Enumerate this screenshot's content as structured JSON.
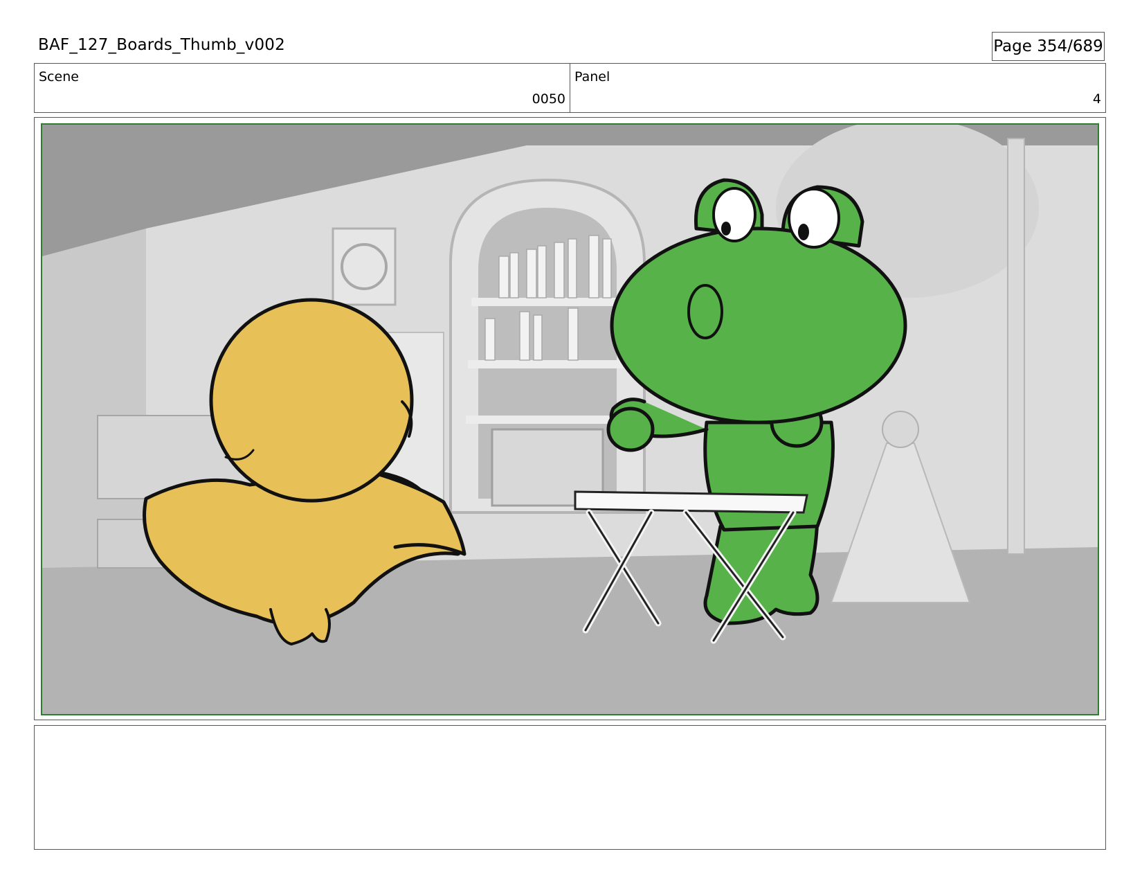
{
  "header": {
    "doc_title": "BAF_127_Boards_Thumb_v002",
    "page_label": "Page 354/689"
  },
  "info": {
    "scene_label": "Scene",
    "scene_value": "0050",
    "panel_label": "Panel",
    "panel_value": "4"
  },
  "notes": {
    "text": ""
  },
  "colors": {
    "frame_border": "#2f7d2f",
    "duck_fill": "#e8c058",
    "frog_fill": "#57b24a"
  }
}
